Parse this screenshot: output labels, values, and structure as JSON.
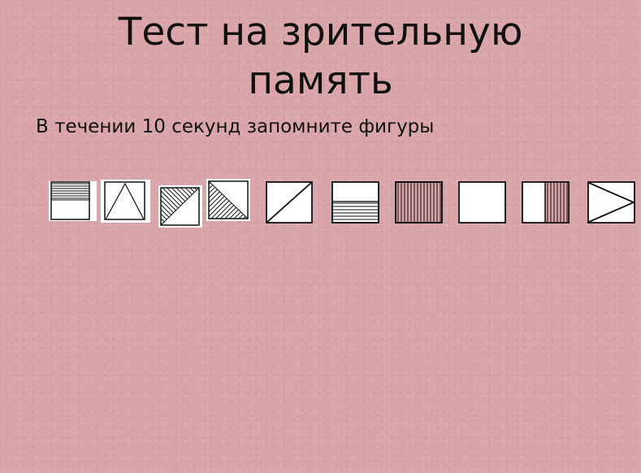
{
  "slide": {
    "title_line1": "Тест на зрительную",
    "title_line2": "память",
    "instruction": "В течении 10 секунд запомните фигуры"
  },
  "figures": [
    {
      "name": "figure-top-half-hatched"
    },
    {
      "name": "figure-triangle"
    },
    {
      "name": "figure-diagonal-half-hatched-lower"
    },
    {
      "name": "figure-diagonal-half-hatched-upper"
    },
    {
      "name": "figure-diagonal-line"
    },
    {
      "name": "figure-bottom-half-horizontal-stripes"
    },
    {
      "name": "figure-vertical-stripes"
    },
    {
      "name": "figure-empty-square"
    },
    {
      "name": "figure-right-half-vertical-stripes"
    },
    {
      "name": "figure-sideways-triangle"
    }
  ]
}
